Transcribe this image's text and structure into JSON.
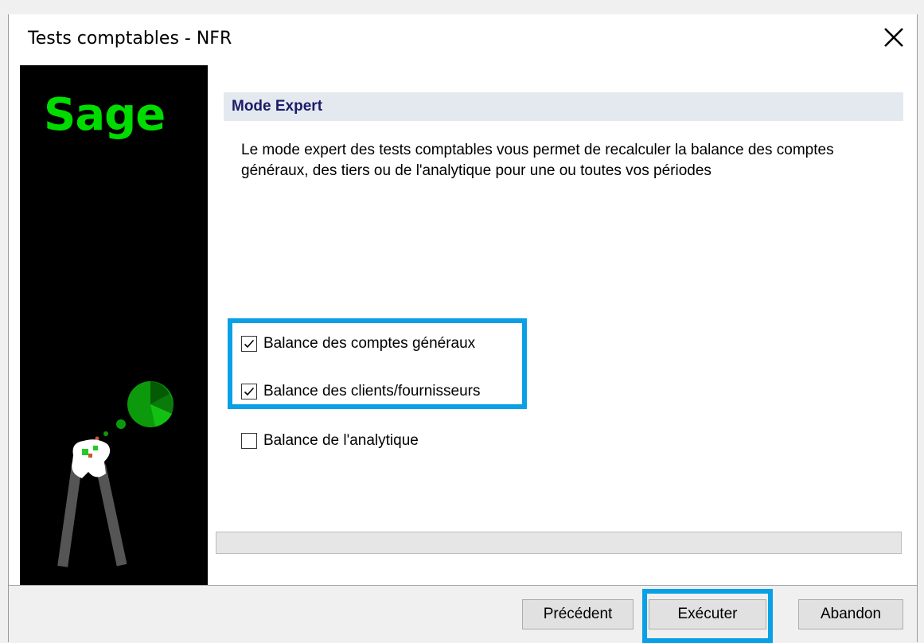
{
  "window": {
    "title": "Tests comptables - NFR"
  },
  "sidebar": {
    "logo_text": "Sage"
  },
  "section": {
    "header": "Mode Expert",
    "description": "Le mode expert des tests comptables vous permet de recalculer la balance des comptes généraux, des tiers ou de l'analytique pour une ou toutes vos périodes"
  },
  "options": [
    {
      "label": "Balance des comptes généraux",
      "checked": true
    },
    {
      "label": "Balance des clients/fournisseurs",
      "checked": true
    },
    {
      "label": "Balance de l'analytique",
      "checked": false
    }
  ],
  "progress": {
    "value": 0
  },
  "buttons": {
    "previous": "Précédent",
    "execute": "Exécuter",
    "cancel": "Abandon"
  },
  "colors": {
    "highlight": "#0aa0e6",
    "brand_green": "#00dc00",
    "header_bg": "#e3e9ef",
    "header_text": "#1c1c6a"
  }
}
